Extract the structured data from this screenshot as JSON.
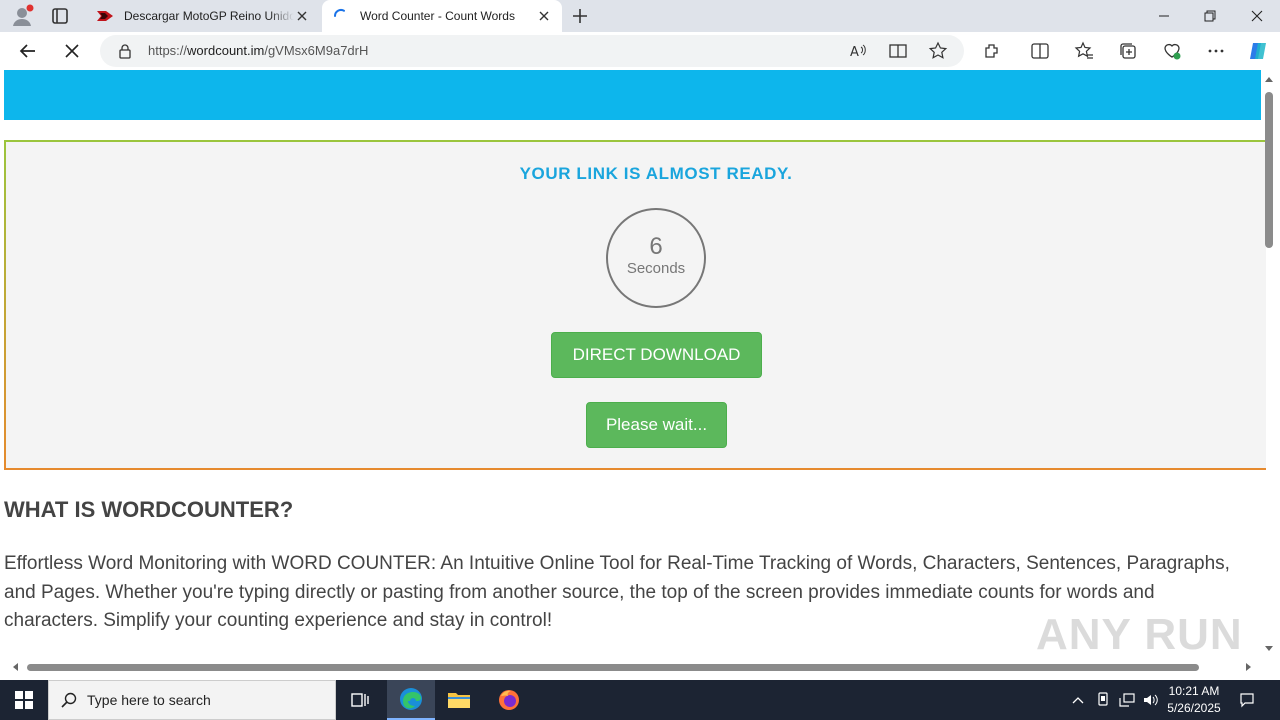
{
  "tabs": [
    {
      "title": "Descargar MotoGP Reino Unido (",
      "active": false
    },
    {
      "title": "Word Counter - Count Words",
      "active": true
    }
  ],
  "address": {
    "scheme": "https://",
    "host": "wordcount.im",
    "path": "/gVMsx6M9a7drH"
  },
  "page": {
    "ready_text": "YOUR LINK IS ALMOST READY.",
    "countdown": {
      "value": "6",
      "unit": "Seconds"
    },
    "download_button": "DIRECT DOWNLOAD",
    "wait_button": "Please wait...",
    "heading": "WHAT IS WORDCOUNTER?",
    "paragraph_lines": [
      "Effortless Word Monitoring with WORD COUNTER: An Intuitive Online Tool for Real-Time Tracking of Words, Characters, Sentences, Paragraphs,",
      "and Pages. Whether you're typing directly or pasting from another source, the top of the screen provides immediate counts for words and",
      "characters. Simplify your counting experience and stay in control!"
    ],
    "watermark": "ANY RUN"
  },
  "taskbar": {
    "search_placeholder": "Type here to search",
    "time": "10:21 AM",
    "date": "5/26/2025"
  },
  "colors": {
    "top_banner": "#0db6ec",
    "ready_text": "#1aa5dd",
    "button_green": "#5cb85c",
    "taskbar": "#1c2433"
  }
}
